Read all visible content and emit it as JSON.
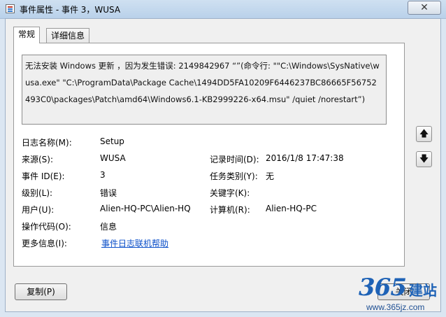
{
  "window": {
    "title": "事件属性 - 事件 3，WUSA",
    "close_glyph": "✕"
  },
  "tabs": [
    {
      "label": "常规",
      "active": true
    },
    {
      "label": "详细信息",
      "active": false
    }
  ],
  "description": "无法安装 Windows 更新 ，因为发生错误: 2149842967 “”(命令行: \"\"C:\\Windows\\SysNative\\wusa.exe\" \"C:\\ProgramData\\Package Cache\\1494DD5FA10209F6446237BC86665F56752493C0\\packages\\Patch\\amd64\\Windows6.1-KB2999226-x64.msu\" /quiet /norestart”)",
  "fields": {
    "log_name": {
      "label": "日志名称(M):",
      "value": "Setup"
    },
    "source": {
      "label": "来源(S):",
      "value": "WUSA"
    },
    "event_id": {
      "label": "事件 ID(E):",
      "value": "3"
    },
    "level": {
      "label": "级别(L):",
      "value": "错误"
    },
    "user": {
      "label": "用户(U):",
      "value": "Alien-HQ-PC\\Alien-HQ"
    },
    "opcode": {
      "label": "操作代码(O):",
      "value": "信息"
    },
    "more_info": {
      "label": "更多信息(I):",
      "link": "事件日志联机帮助"
    },
    "logged": {
      "label": "记录时间(D):",
      "value": "2016/1/8 17:47:38"
    },
    "task_category": {
      "label": "任务类别(Y):",
      "value": "无"
    },
    "keywords": {
      "label": "关键字(K):",
      "value": ""
    },
    "computer": {
      "label": "计算机(R):",
      "value": "Alien-HQ-PC"
    }
  },
  "buttons": {
    "copy": "复制(P)",
    "close": "关闭",
    "up_glyph": "🡅",
    "down_glyph": "🡇"
  },
  "watermark": {
    "logo": "365",
    "cn": "建站",
    "url": "www.365jz.com"
  },
  "icons": [
    "event-viewer-icon",
    "close-icon",
    "up-arrow-icon",
    "down-arrow-icon"
  ]
}
